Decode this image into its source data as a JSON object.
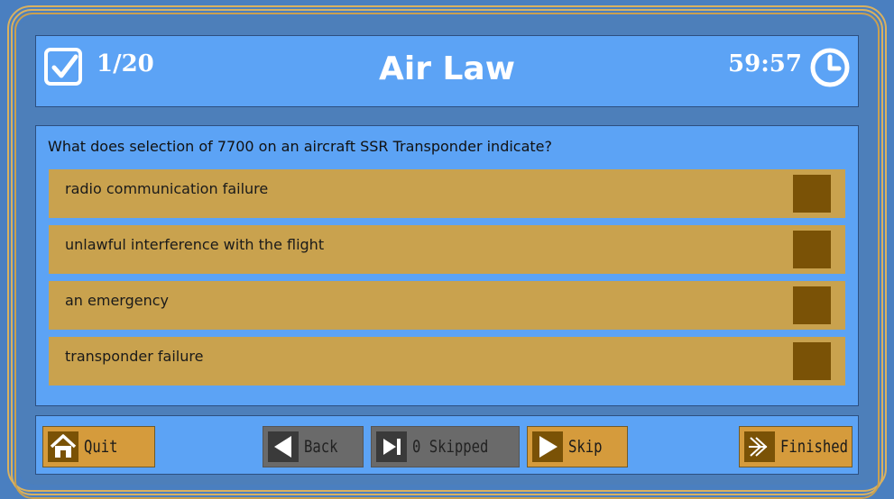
{
  "header": {
    "progress": "1/20",
    "title": "Air Law",
    "timer": "59:57"
  },
  "question": {
    "text": "What does selection of 7700 on an aircraft SSR Transponder indicate?",
    "answers": [
      {
        "label": "radio communication failure",
        "selected": false
      },
      {
        "label": "unlawful interference with the flight",
        "selected": false
      },
      {
        "label": "an emergency",
        "selected": false
      },
      {
        "label": "transponder failure",
        "selected": false
      }
    ]
  },
  "footer": {
    "quit_label": "Quit",
    "back_label": "Back",
    "skipped_label": "0 Skipped",
    "skip_label": "Skip",
    "finished_label": "Finished"
  },
  "colors": {
    "background": "#4a7fc0",
    "panel": "#5ca3f5",
    "answer": "#c9a24e",
    "answer_box": "#7a5206",
    "button_gold": "#d59b3c",
    "button_gray": "#6a6a6a",
    "frame_gold": "#d9b160"
  }
}
